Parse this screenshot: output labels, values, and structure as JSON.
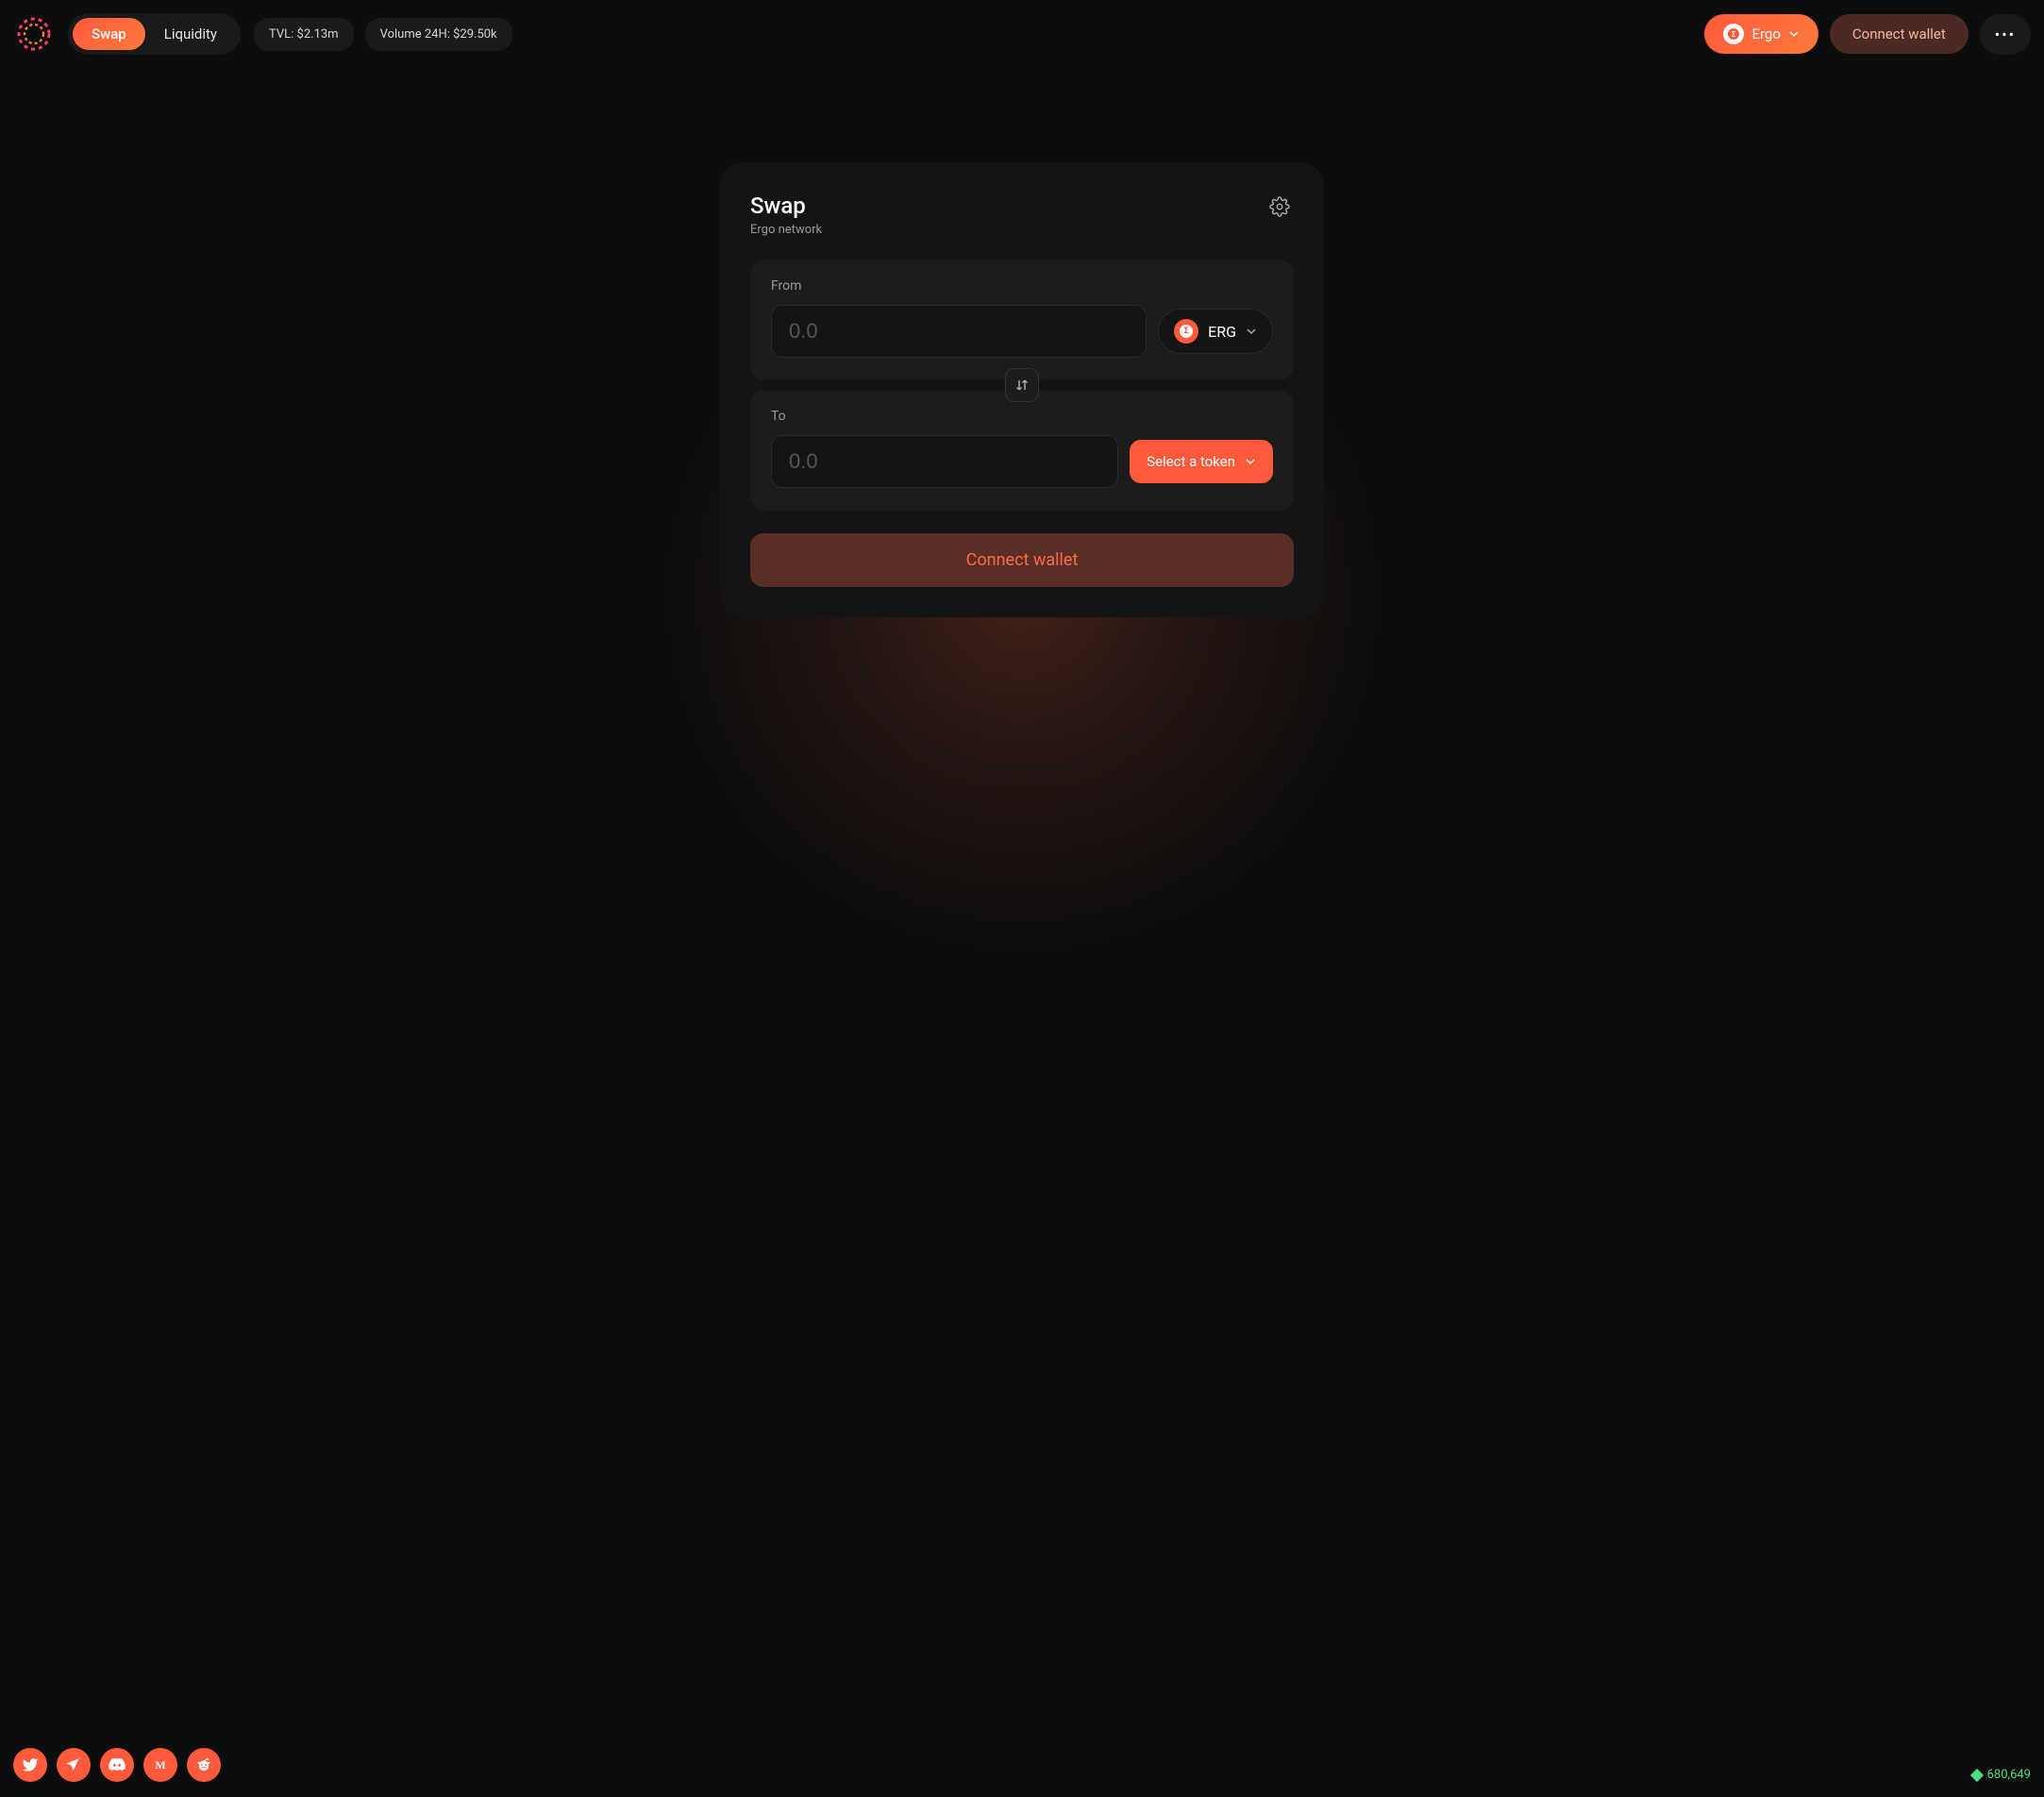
{
  "header": {
    "nav": {
      "swap": "Swap",
      "liquidity": "Liquidity"
    },
    "stats": {
      "tvl": "TVL: $2.13m",
      "volume24h": "Volume 24H: $29.50k"
    },
    "network_label": "Ergo",
    "connect_wallet": "Connect wallet"
  },
  "swap": {
    "title": "Swap",
    "subtitle": "Ergo network",
    "from_label": "From",
    "to_label": "To",
    "from_token": "ERG",
    "amount_placeholder": "0.0",
    "select_token_label": "Select a token",
    "connect_wallet_btn": "Connect wallet"
  },
  "footer": {
    "block_number": "680,649"
  },
  "social": {
    "twitter": "twitter",
    "telegram": "telegram",
    "discord": "discord",
    "medium": "medium",
    "reddit": "reddit"
  }
}
